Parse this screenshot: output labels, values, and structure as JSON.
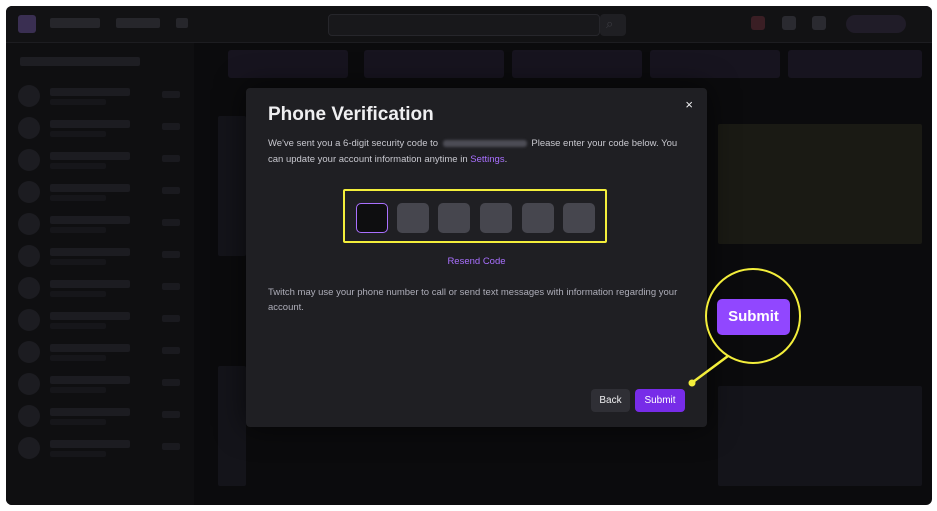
{
  "modal": {
    "title": "Phone Verification",
    "desc_before": "We've sent you a 6-digit security code to",
    "desc_middle": "Please enter your code below. You can update your account information anytime in",
    "desc_link": "Settings",
    "desc_end": ".",
    "code_digits": [
      "",
      "",
      "",
      "",
      "",
      ""
    ],
    "resend_label": "Resend Code",
    "notice": "Twitch may use your phone number to call or send text messages with information regarding your account.",
    "back_label": "Back",
    "submit_label": "Submit",
    "close_glyph": "×"
  },
  "callout": {
    "label": "Submit"
  },
  "colors": {
    "accent": "#9147ff",
    "submit": "#772ce8",
    "highlight": "#f3ee3b",
    "modal_bg": "#1f1f23"
  }
}
